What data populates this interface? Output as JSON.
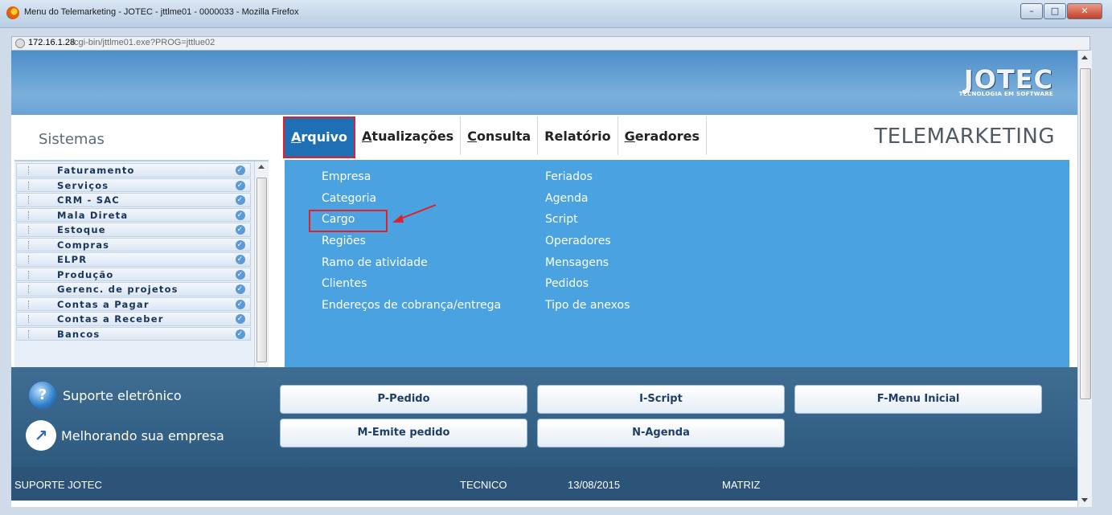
{
  "window": {
    "title": "Menu do Telemarketing - JOTEC - jttlme01 - 0000033 - Mozilla Firefox",
    "controls": {
      "minimize": "–",
      "maximize": "□",
      "close": "✕"
    }
  },
  "address": {
    "host": "172.16.1.28",
    "path": "/cgi-bin/jttlme01.exe?PROG=jttlue02"
  },
  "logo": {
    "main": "JOTEC",
    "tagline": "TECNOLOGIA EM SOFTWARE"
  },
  "header": {
    "sistemas_label": "Sistemas",
    "module_title": "TELEMARKETING"
  },
  "menu": {
    "items": [
      {
        "first": "A",
        "rest": "rquivo",
        "active": true
      },
      {
        "first": "A",
        "rest": "tualizações",
        "active": false
      },
      {
        "first": "C",
        "rest": "onsulta",
        "active": false
      },
      {
        "first": "R",
        "rest": "elatório",
        "active": false,
        "underline_second": true
      },
      {
        "first": "G",
        "rest": "eradores",
        "active": false
      }
    ]
  },
  "modules": [
    "Faturamento",
    "Serviços",
    "CRM - SAC",
    "Mala Direta",
    "Estoque",
    "Compras",
    "ELPR",
    "Produção",
    "Gerenc. de projetos",
    "Contas a Pagar",
    "Contas a Receber",
    "Bancos"
  ],
  "dropdown": {
    "col1": [
      "Empresa",
      "Categoria",
      "Cargo",
      "Regiões",
      "Ramo de atividade",
      "Clientes",
      "Endereços de cobrança/entrega"
    ],
    "col2": [
      "Feriados",
      "Agenda",
      "Script",
      "Operadores",
      "Mensagens",
      "Pedidos",
      "Tipo de anexos"
    ],
    "highlighted": "Cargo"
  },
  "bottom": {
    "support_label": "Suporte eletrônico",
    "improve_label": "Melhorando sua empresa",
    "buttons": {
      "pedido": "P-Pedido",
      "script": "I-Script",
      "menu_inicial": "F-Menu Inicial",
      "emite_pedido": "M-Emite pedido",
      "agenda": "N-Agenda"
    }
  },
  "status": {
    "left": "SUPORTE JOTEC",
    "user": "TECNICO",
    "date": "13/08/2015",
    "branch": "MATRIZ"
  },
  "colors": {
    "menu_active": "#1f6fb5",
    "dropdown_bg": "#4aa3e0",
    "highlight": "#e61e2b",
    "status_bg": "#2b5478"
  }
}
